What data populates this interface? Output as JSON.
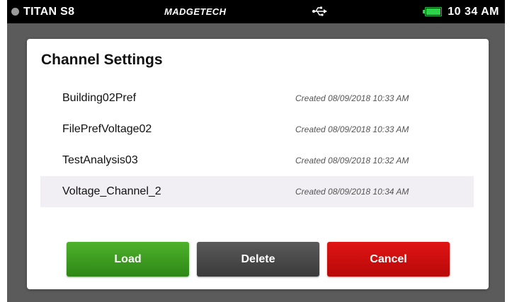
{
  "status_bar": {
    "device_name": "TITAN S8",
    "brand": "MADGETECH",
    "time": "10 34 AM",
    "usb_icon": "usb-icon",
    "battery_icon": "battery-icon"
  },
  "dialog": {
    "title": "Channel Settings",
    "items": [
      {
        "name": "Building02Pref",
        "created": "Created 08/09/2018 10:33 AM"
      },
      {
        "name": "FilePrefVoltage02",
        "created": "Created 08/09/2018 10:33 AM"
      },
      {
        "name": "TestAnalysis03",
        "created": "Created 08/09/2018 10:32 AM"
      },
      {
        "name": "Voltage_Channel_2",
        "created": "Created 08/09/2018 10:34 AM"
      }
    ],
    "buttons": {
      "load": "Load",
      "delete": "Delete",
      "cancel": "Cancel"
    }
  },
  "colors": {
    "load": "#3a9b20",
    "delete": "#4a4a4a",
    "cancel": "#d01010",
    "selected_row": "#f1eff3"
  }
}
